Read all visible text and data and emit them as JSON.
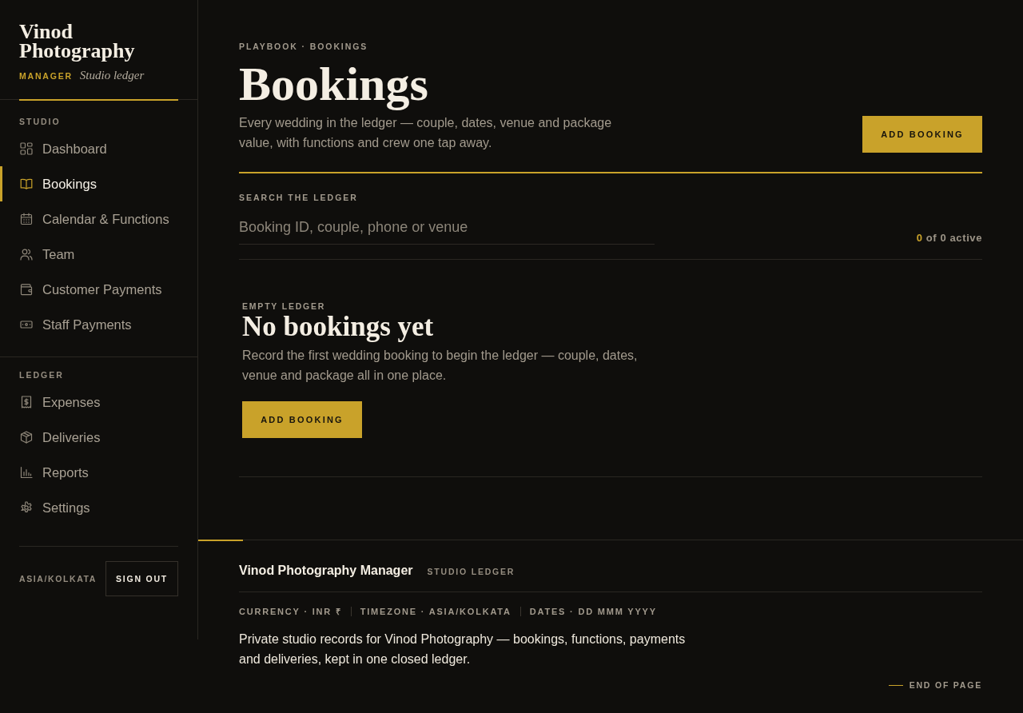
{
  "sidebar": {
    "brand": {
      "title": "Vinod Photography",
      "role": "MANAGER",
      "tagline": "Studio ledger"
    },
    "sections": [
      {
        "label": "STUDIO",
        "items": [
          {
            "label": "Dashboard",
            "selected": false
          },
          {
            "label": "Bookings",
            "selected": true
          },
          {
            "label": "Calendar & Functions",
            "selected": false
          },
          {
            "label": "Team",
            "selected": false
          },
          {
            "label": "Customer Payments",
            "selected": false
          },
          {
            "label": "Staff Payments",
            "selected": false
          }
        ]
      },
      {
        "label": "LEDGER",
        "items": [
          {
            "label": "Expenses",
            "selected": false
          },
          {
            "label": "Deliveries",
            "selected": false
          },
          {
            "label": "Reports",
            "selected": false
          },
          {
            "label": "Settings",
            "selected": false
          }
        ]
      }
    ],
    "timezone": "ASIA/KOLKATA",
    "sign_out": "SIGN OUT"
  },
  "header": {
    "breadcrumb": "PLAYBOOK · BOOKINGS",
    "title": "Bookings",
    "description": "Every wedding in the ledger — couple, dates, venue and package value, with functions and crew one tap away.",
    "action": "ADD BOOKING"
  },
  "search": {
    "label": "SEARCH THE LEDGER",
    "placeholder": "Booking ID, couple, phone or venue",
    "count": "0",
    "count_label": "of 0 active"
  },
  "empty_state": {
    "eyebrow": "EMPTY LEDGER",
    "title": "No bookings yet",
    "description": "Record the first wedding booking to begin the ledger — couple, dates, venue and package all in one place.",
    "action": "ADD BOOKING"
  },
  "footer": {
    "title": "Vinod Photography Manager",
    "subtitle": "STUDIO LEDGER",
    "meta": [
      "CURRENCY · INR ₹",
      "TIMEZONE · ASIA/KOLKATA",
      "DATES · DD MMM YYYY"
    ],
    "description": "Private studio records for Vinod Photography — bookings, functions, payments and deliveries, kept in one closed ledger.",
    "end_label": "END OF PAGE"
  }
}
